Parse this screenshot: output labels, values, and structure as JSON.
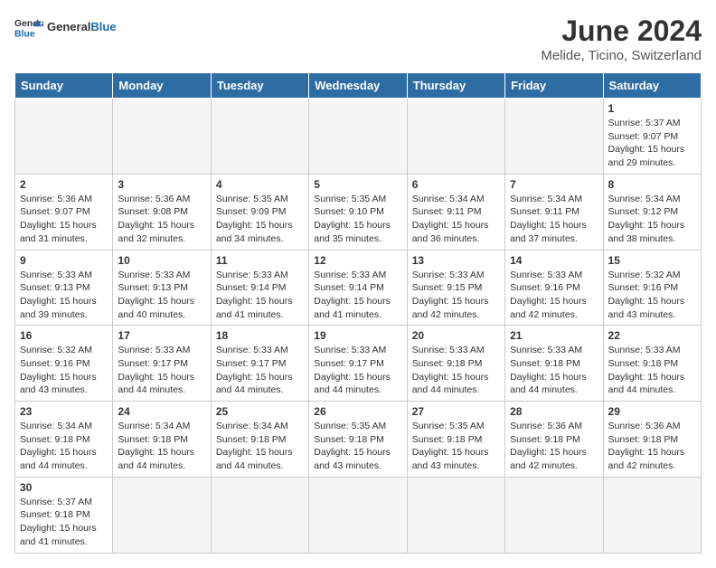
{
  "header": {
    "logo_general": "General",
    "logo_blue": "Blue",
    "title": "June 2024",
    "subtitle": "Melide, Ticino, Switzerland"
  },
  "columns": [
    "Sunday",
    "Monday",
    "Tuesday",
    "Wednesday",
    "Thursday",
    "Friday",
    "Saturday"
  ],
  "weeks": [
    [
      {
        "day": "",
        "info": ""
      },
      {
        "day": "",
        "info": ""
      },
      {
        "day": "",
        "info": ""
      },
      {
        "day": "",
        "info": ""
      },
      {
        "day": "",
        "info": ""
      },
      {
        "day": "",
        "info": ""
      },
      {
        "day": "1",
        "info": "Sunrise: 5:37 AM\nSunset: 9:07 PM\nDaylight: 15 hours\nand 29 minutes."
      }
    ],
    [
      {
        "day": "2",
        "info": "Sunrise: 5:36 AM\nSunset: 9:07 PM\nDaylight: 15 hours\nand 31 minutes."
      },
      {
        "day": "3",
        "info": "Sunrise: 5:36 AM\nSunset: 9:08 PM\nDaylight: 15 hours\nand 32 minutes."
      },
      {
        "day": "4",
        "info": "Sunrise: 5:35 AM\nSunset: 9:09 PM\nDaylight: 15 hours\nand 34 minutes."
      },
      {
        "day": "5",
        "info": "Sunrise: 5:35 AM\nSunset: 9:10 PM\nDaylight: 15 hours\nand 35 minutes."
      },
      {
        "day": "6",
        "info": "Sunrise: 5:34 AM\nSunset: 9:11 PM\nDaylight: 15 hours\nand 36 minutes."
      },
      {
        "day": "7",
        "info": "Sunrise: 5:34 AM\nSunset: 9:11 PM\nDaylight: 15 hours\nand 37 minutes."
      },
      {
        "day": "8",
        "info": "Sunrise: 5:34 AM\nSunset: 9:12 PM\nDaylight: 15 hours\nand 38 minutes."
      }
    ],
    [
      {
        "day": "9",
        "info": "Sunrise: 5:33 AM\nSunset: 9:13 PM\nDaylight: 15 hours\nand 39 minutes."
      },
      {
        "day": "10",
        "info": "Sunrise: 5:33 AM\nSunset: 9:13 PM\nDaylight: 15 hours\nand 40 minutes."
      },
      {
        "day": "11",
        "info": "Sunrise: 5:33 AM\nSunset: 9:14 PM\nDaylight: 15 hours\nand 41 minutes."
      },
      {
        "day": "12",
        "info": "Sunrise: 5:33 AM\nSunset: 9:14 PM\nDaylight: 15 hours\nand 41 minutes."
      },
      {
        "day": "13",
        "info": "Sunrise: 5:33 AM\nSunset: 9:15 PM\nDaylight: 15 hours\nand 42 minutes."
      },
      {
        "day": "14",
        "info": "Sunrise: 5:33 AM\nSunset: 9:16 PM\nDaylight: 15 hours\nand 42 minutes."
      },
      {
        "day": "15",
        "info": "Sunrise: 5:32 AM\nSunset: 9:16 PM\nDaylight: 15 hours\nand 43 minutes."
      }
    ],
    [
      {
        "day": "16",
        "info": "Sunrise: 5:32 AM\nSunset: 9:16 PM\nDaylight: 15 hours\nand 43 minutes."
      },
      {
        "day": "17",
        "info": "Sunrise: 5:33 AM\nSunset: 9:17 PM\nDaylight: 15 hours\nand 44 minutes."
      },
      {
        "day": "18",
        "info": "Sunrise: 5:33 AM\nSunset: 9:17 PM\nDaylight: 15 hours\nand 44 minutes."
      },
      {
        "day": "19",
        "info": "Sunrise: 5:33 AM\nSunset: 9:17 PM\nDaylight: 15 hours\nand 44 minutes."
      },
      {
        "day": "20",
        "info": "Sunrise: 5:33 AM\nSunset: 9:18 PM\nDaylight: 15 hours\nand 44 minutes."
      },
      {
        "day": "21",
        "info": "Sunrise: 5:33 AM\nSunset: 9:18 PM\nDaylight: 15 hours\nand 44 minutes."
      },
      {
        "day": "22",
        "info": "Sunrise: 5:33 AM\nSunset: 9:18 PM\nDaylight: 15 hours\nand 44 minutes."
      }
    ],
    [
      {
        "day": "23",
        "info": "Sunrise: 5:34 AM\nSunset: 9:18 PM\nDaylight: 15 hours\nand 44 minutes."
      },
      {
        "day": "24",
        "info": "Sunrise: 5:34 AM\nSunset: 9:18 PM\nDaylight: 15 hours\nand 44 minutes."
      },
      {
        "day": "25",
        "info": "Sunrise: 5:34 AM\nSunset: 9:18 PM\nDaylight: 15 hours\nand 44 minutes."
      },
      {
        "day": "26",
        "info": "Sunrise: 5:35 AM\nSunset: 9:18 PM\nDaylight: 15 hours\nand 43 minutes."
      },
      {
        "day": "27",
        "info": "Sunrise: 5:35 AM\nSunset: 9:18 PM\nDaylight: 15 hours\nand 43 minutes."
      },
      {
        "day": "28",
        "info": "Sunrise: 5:36 AM\nSunset: 9:18 PM\nDaylight: 15 hours\nand 42 minutes."
      },
      {
        "day": "29",
        "info": "Sunrise: 5:36 AM\nSunset: 9:18 PM\nDaylight: 15 hours\nand 42 minutes."
      }
    ],
    [
      {
        "day": "30",
        "info": "Sunrise: 5:37 AM\nSunset: 9:18 PM\nDaylight: 15 hours\nand 41 minutes."
      },
      {
        "day": "",
        "info": ""
      },
      {
        "day": "",
        "info": ""
      },
      {
        "day": "",
        "info": ""
      },
      {
        "day": "",
        "info": ""
      },
      {
        "day": "",
        "info": ""
      },
      {
        "day": "",
        "info": ""
      }
    ]
  ]
}
